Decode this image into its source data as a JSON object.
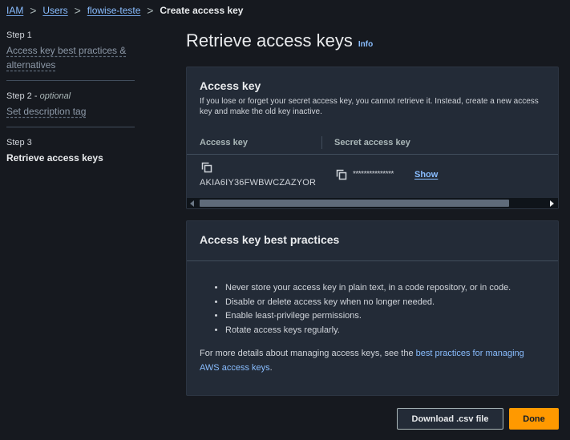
{
  "breadcrumb": {
    "items": [
      "IAM",
      "Users",
      "flowise-teste"
    ],
    "current": "Create access key",
    "separator": ">"
  },
  "steps": [
    {
      "label": "Step 1",
      "title": "Access key best practices & alternatives"
    },
    {
      "label": "Step 2",
      "optional": "optional",
      "title": "Set description tag"
    },
    {
      "label": "Step 3",
      "title": "Retrieve access keys"
    }
  ],
  "page": {
    "title": "Retrieve access keys",
    "info": "Info"
  },
  "access_key_panel": {
    "title": "Access key",
    "description": "If you lose or forget your secret access key, you cannot retrieve it. Instead, create a new access key and make the old key inactive.",
    "columns": [
      "Access key",
      "Secret access key"
    ],
    "access_key_value": "AKIA6IY36FWBWCZAZYOR",
    "secret_masked": "***************",
    "show_label": "Show"
  },
  "best_practices_panel": {
    "title": "Access key best practices",
    "items": [
      "Never store your access key in plain text, in a code repository, or in code.",
      "Disable or delete access key when no longer needed.",
      "Enable least-privilege permissions.",
      "Rotate access keys regularly."
    ],
    "footer_prefix": "For more details about managing access keys, see the ",
    "footer_link": "best practices for managing AWS access keys",
    "footer_suffix": "."
  },
  "actions": {
    "download": "Download .csv file",
    "done": "Done"
  },
  "icons": {
    "copy": "copy-icon",
    "breadcrumb_separator": "chevron-right-icon",
    "scroll_left": "scroll-left-arrow-icon",
    "scroll_right": "scroll-right-arrow-icon"
  },
  "colors": {
    "background": "#16191f",
    "panel": "#232b37",
    "link": "#89bdff",
    "primary_button": "#ff9900"
  }
}
